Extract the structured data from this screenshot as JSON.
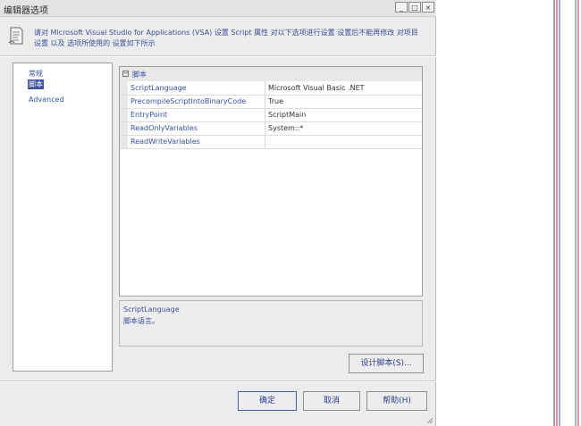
{
  "window": {
    "title": "编辑器选项",
    "buttons": {
      "minimize": "_",
      "maximize": "□",
      "close": "×"
    }
  },
  "header": {
    "description": "请对 Microsoft Visual Studio for Applications (VSA) 设置 Script 属性 对以下选项进行设置 设置后不能再修改 对项目设置 以及 选项所使用的 设置如下所示"
  },
  "nav": {
    "items": [
      {
        "label": "常规",
        "selected": false
      },
      {
        "label": "脚本",
        "selected": true
      },
      {
        "label": "Advanced",
        "selected": false
      }
    ]
  },
  "properties": {
    "category": "脚本",
    "rows": [
      {
        "name": "ScriptLanguage",
        "value": "Microsoft Visual Basic .NET"
      },
      {
        "name": "PrecompileScriptIntoBinaryCode",
        "value": "True"
      },
      {
        "name": "EntryPoint",
        "value": "ScriptMain"
      },
      {
        "name": "ReadOnlyVariables",
        "value": "System::*"
      },
      {
        "name": "ReadWriteVariables",
        "value": ""
      }
    ]
  },
  "description_panel": {
    "title": "ScriptLanguage",
    "text": "脚本语言。"
  },
  "buttons": {
    "design_script": "设计脚本(S)...",
    "ok": "确定",
    "cancel": "取消",
    "help": "帮助(H)"
  },
  "colors": {
    "accent": "#3b4f9b",
    "dialog_bg": "#ececec"
  }
}
